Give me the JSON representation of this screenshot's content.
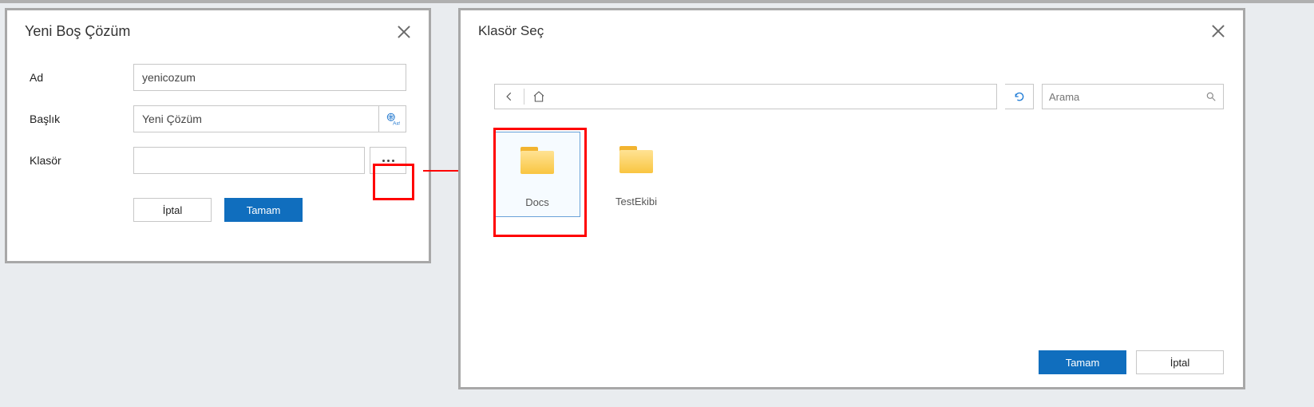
{
  "leftDialog": {
    "title": "Yeni Boş Çözüm",
    "labels": {
      "ad": "Ad",
      "baslik": "Başlık",
      "klasor": "Klasör"
    },
    "values": {
      "ad": "yenicozum",
      "baslik": "Yeni Çözüm",
      "klasor": ""
    },
    "buttons": {
      "cancel": "İptal",
      "ok": "Tamam"
    }
  },
  "rightDialog": {
    "title": "Klasör Seç",
    "searchPlaceholder": "Arama",
    "folders": [
      {
        "name": "Docs",
        "selected": true
      },
      {
        "name": "TestEkibi",
        "selected": false
      }
    ],
    "buttons": {
      "ok": "Tamam",
      "cancel": "İptal"
    }
  }
}
